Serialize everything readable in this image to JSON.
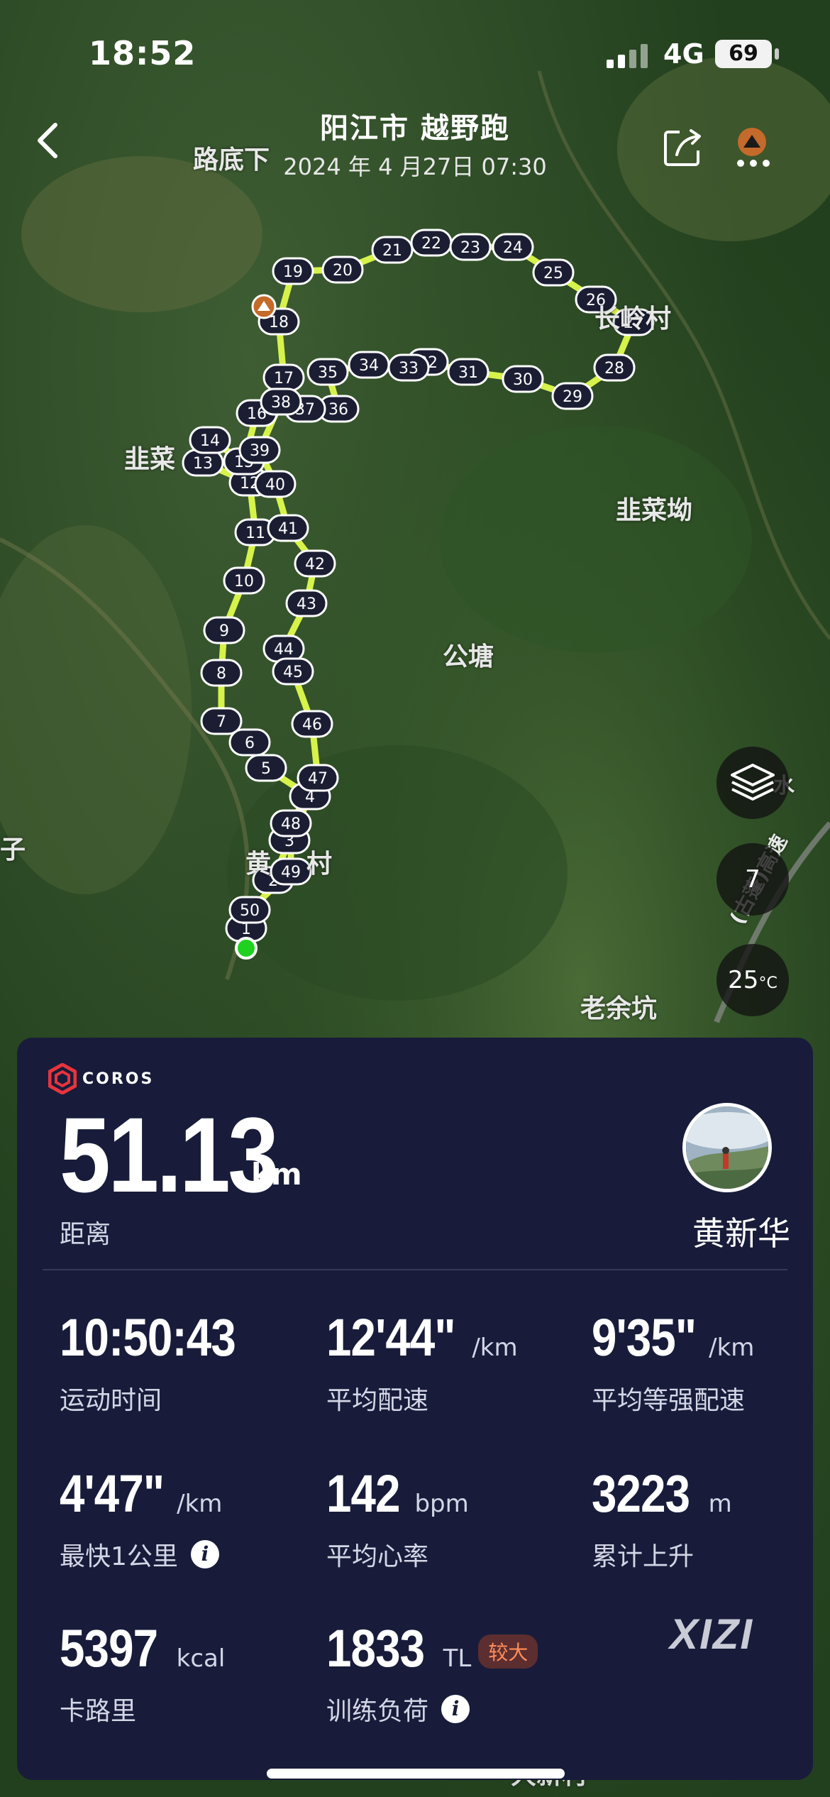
{
  "status_bar": {
    "time": "18:52",
    "network": "4G",
    "battery": "69"
  },
  "header": {
    "title": "阳江市 越野跑",
    "subtitle": "2024 年 4 月27日 07:30",
    "back_icon": "chevron-left-icon",
    "share_icon": "share-icon",
    "more_icon": "more-icon"
  },
  "map": {
    "places": [
      "路底下",
      "长岭村",
      "韭菜",
      "韭菜坳",
      "公塘",
      "黄",
      "村",
      "子",
      "老余坑",
      "大新村",
      "水",
      "(古蓬)高速"
    ],
    "route_color": "#d7f24a",
    "km_markers": [
      "1",
      "2",
      "3",
      "4",
      "5",
      "6",
      "7",
      "8",
      "9",
      "10",
      "11",
      "12",
      "13",
      "14",
      "15",
      "16",
      "17",
      "18",
      "19",
      "20",
      "21",
      "22",
      "23",
      "24",
      "25",
      "26",
      "27",
      "28",
      "29",
      "30",
      "31",
      "32",
      "33",
      "34",
      "35",
      "36",
      "37",
      "38",
      "39",
      "40",
      "41",
      "42",
      "43",
      "44",
      "45",
      "46",
      "47",
      "48",
      "49",
      "50"
    ],
    "controls": {
      "layers_icon": "layers-icon",
      "compass_value": "7",
      "temperature": "25",
      "temperature_unit": "°C"
    }
  },
  "card": {
    "brand": "COROS",
    "distance": {
      "value": "51.13",
      "unit": "km",
      "label": "距离"
    },
    "user": {
      "name": "黄新华"
    },
    "stats": [
      {
        "value": "10:50:43",
        "unit": "",
        "label": "运动时间"
      },
      {
        "value": "12'44\"",
        "unit": "/km",
        "label": "平均配速"
      },
      {
        "value": "9'35\"",
        "unit": "/km",
        "label": "平均等强配速"
      },
      {
        "value": "4'47\"",
        "unit": "/km",
        "label": "最快1公里"
      },
      {
        "value": "142",
        "unit": "bpm",
        "label": "平均心率"
      },
      {
        "value": "3223",
        "unit": "m",
        "label": "累计上升"
      },
      {
        "value": "5397",
        "unit": "kcal",
        "label": "卡路里"
      },
      {
        "value": "1833",
        "unit": "TL",
        "label": "训练负荷",
        "tag": "较大"
      }
    ],
    "watermark": "XIZI"
  }
}
